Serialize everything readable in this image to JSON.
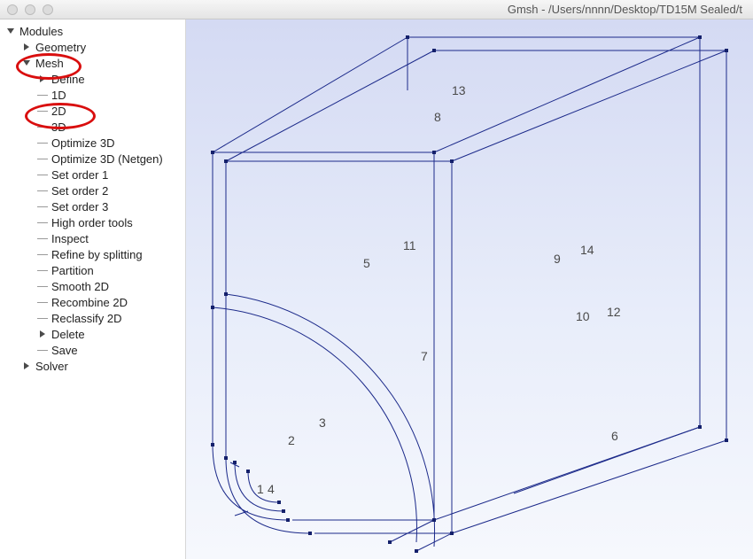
{
  "window": {
    "title": "Gmsh - /Users/nnnn/Desktop/TD15M Sealed/t"
  },
  "tree": {
    "modules_label": "Modules",
    "geometry_label": "Geometry",
    "mesh_label": "Mesh",
    "define_label": "Define",
    "items": {
      "i0": "1D",
      "i1": "2D",
      "i2": "3D",
      "i3": "Optimize 3D",
      "i4": "Optimize 3D (Netgen)",
      "i5": "Set order 1",
      "i6": "Set order 2",
      "i7": "Set order 3",
      "i8": "High order tools",
      "i9": "Inspect",
      "i10": "Refine by splitting",
      "i11": "Partition",
      "i12": "Smooth 2D",
      "i13": "Recombine 2D",
      "i14": "Reclassify 2D"
    },
    "delete_label": "Delete",
    "save_label": "Save",
    "solver_label": "Solver"
  },
  "surface_labels": {
    "l1": "1",
    "l2": "2",
    "l3": "3",
    "l4": "4",
    "l5": "5",
    "l6": "6",
    "l7": "7",
    "l8": "8",
    "l9": "9",
    "l10": "10",
    "l11": "11",
    "l12": "12",
    "l13": "13",
    "l14": "14"
  }
}
